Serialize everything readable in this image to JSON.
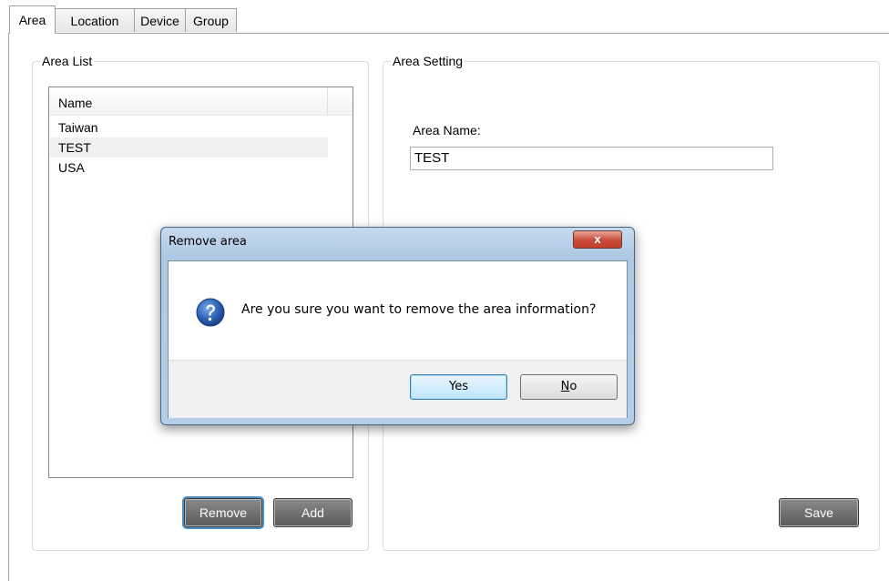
{
  "tabs": [
    {
      "label": "Area",
      "active": true
    },
    {
      "label": "Location",
      "active": false
    },
    {
      "label": "Device",
      "active": false
    },
    {
      "label": "Group",
      "active": false
    }
  ],
  "area_list": {
    "title": "Area List",
    "column_header": "Name",
    "rows": [
      "Taiwan",
      "TEST",
      "USA"
    ],
    "selected_index": 1,
    "remove_label": "Remove",
    "add_label": "Add"
  },
  "area_setting": {
    "title": "Area Setting",
    "name_label": "Area Name:",
    "name_value": "TEST",
    "save_label": "Save"
  },
  "dialog": {
    "title": "Remove area",
    "close_glyph": "x",
    "message": "Are you sure you want to remove the area information?",
    "icon": "question-icon",
    "yes_label": "Yes",
    "no_mnemonic": "N",
    "no_rest": "o"
  },
  "colors": {
    "dialog_frame": "#afc9e4",
    "close_button": "#c94a37",
    "question_icon": "#2d5fb3"
  }
}
